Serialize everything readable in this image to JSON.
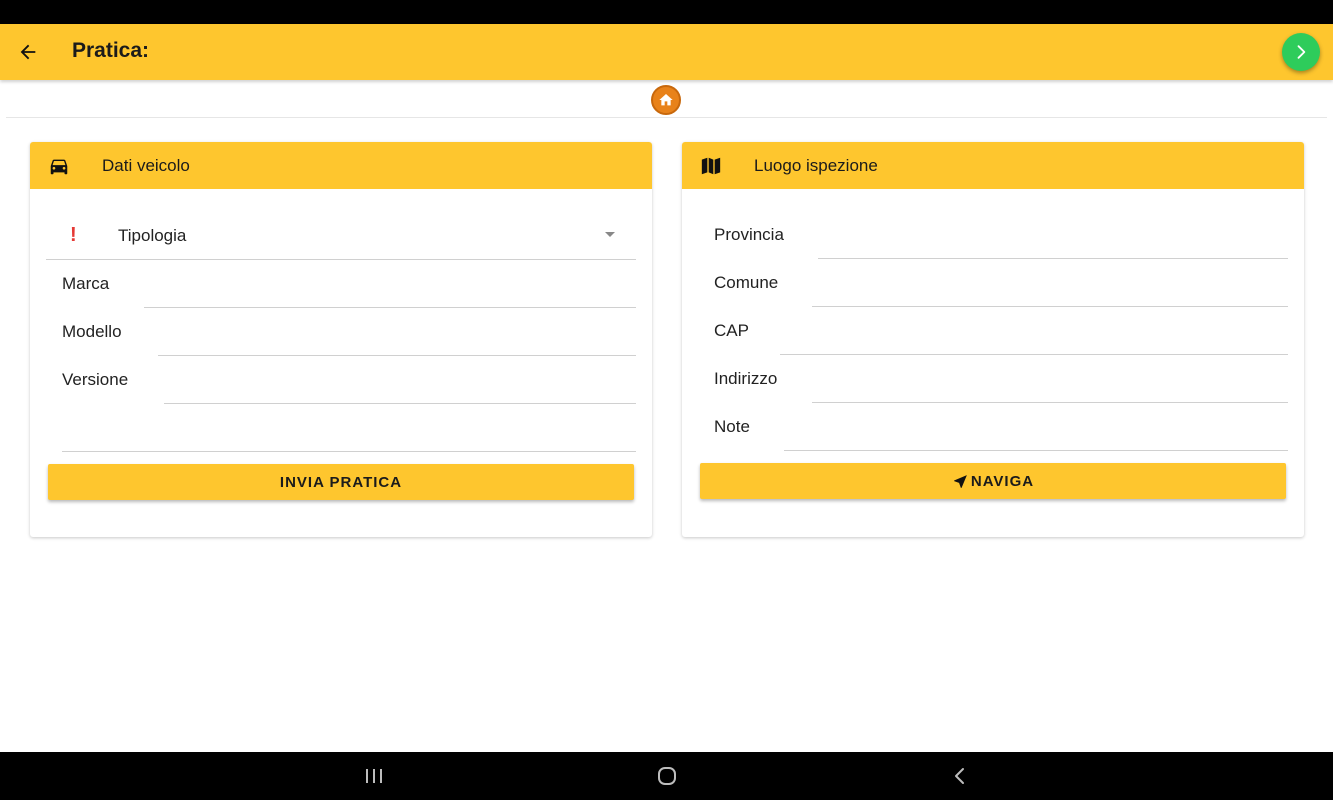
{
  "app_bar": {
    "title": "Pratica:",
    "back_icon": "arrow-left-icon",
    "next_icon": "chevron-right-icon",
    "next_color": "#2ecc5b"
  },
  "home": {
    "icon": "home-icon",
    "color": "#e8821a"
  },
  "vehicle_card": {
    "title": "Dati veicolo",
    "icon": "car-icon",
    "type_select": {
      "label": "Tipologia",
      "required_icon": "exclamation-icon"
    },
    "fields": [
      {
        "label": "Marca",
        "value": ""
      },
      {
        "label": "Modello",
        "value": ""
      },
      {
        "label": "Versione",
        "value": ""
      }
    ],
    "extra_field_value": "",
    "submit_label": "INVIA PRATICA"
  },
  "location_card": {
    "title": "Luogo ispezione",
    "icon": "map-icon",
    "fields": [
      {
        "label": "Provincia",
        "value": ""
      },
      {
        "label": "Comune",
        "value": ""
      },
      {
        "label": "CAP",
        "value": ""
      },
      {
        "label": "Indirizzo",
        "value": ""
      },
      {
        "label": "Note",
        "value": ""
      }
    ],
    "navigate_label": "NAVIGA",
    "navigate_icon": "navigation-arrow-icon"
  },
  "system_nav": {
    "recents_icon": "recents-icon",
    "home_icon": "circle-home-icon",
    "back_icon": "chevron-left-icon"
  },
  "colors": {
    "accent": "#fec62e",
    "warning": "#e53935",
    "text": "#222222"
  }
}
